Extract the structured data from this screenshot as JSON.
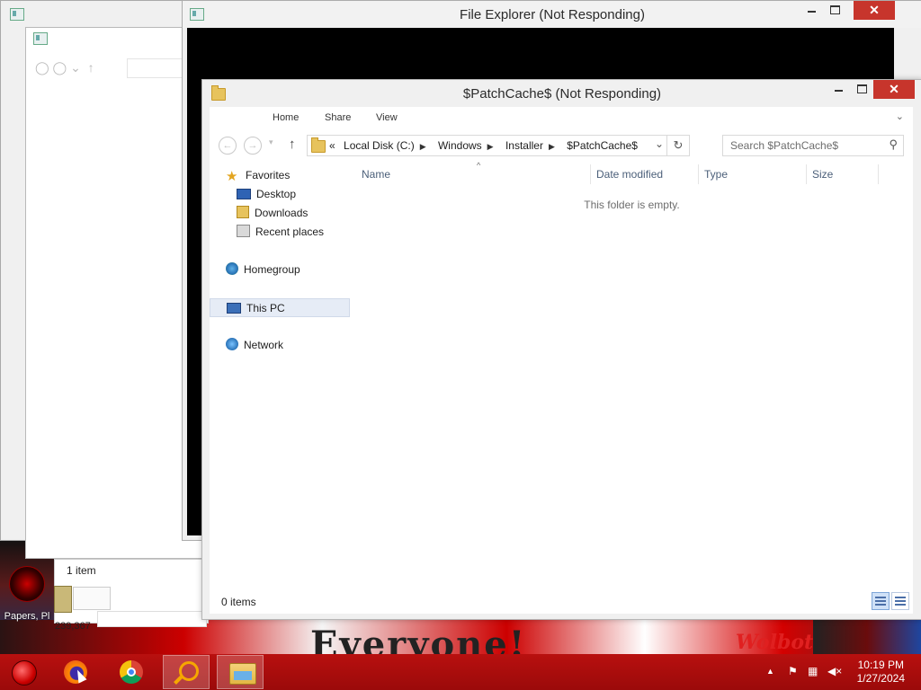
{
  "desktop": {
    "icon_label": "Papers, Pl",
    "wallpaper_text": "Everyone!",
    "wallpaper_text_right": "Wolbot"
  },
  "bg_window_left": {
    "status_count": "1 item",
    "value_label": "239,367"
  },
  "bg_window_main": {
    "title": "File Explorer (Not Responding)"
  },
  "window": {
    "title": "$PatchCache$ (Not Responding)",
    "ribbon_tabs": [
      "Home",
      "Share",
      "View"
    ],
    "breadcrumb": {
      "overflow": "«",
      "parts": [
        "Local Disk (C:)",
        "Windows",
        "Installer",
        "$PatchCache$"
      ]
    },
    "search_placeholder": "Search $PatchCache$",
    "nav": {
      "favorites": "Favorites",
      "desktop": "Desktop",
      "downloads": "Downloads",
      "recent": "Recent places",
      "homegroup": "Homegroup",
      "thispc": "This PC",
      "network": "Network"
    },
    "columns": [
      "Name",
      "Date modified",
      "Type",
      "Size"
    ],
    "empty_message": "This folder is empty.",
    "status_count": "0 items"
  },
  "caption": {
    "close_glyph": "✕"
  },
  "taskbar": {
    "time": "10:19 PM",
    "date": "1/27/2024"
  },
  "colors": {
    "taskbar": "#a00a0a",
    "close_button": "#c7352c",
    "selected_nav": "#e6ecf6"
  }
}
